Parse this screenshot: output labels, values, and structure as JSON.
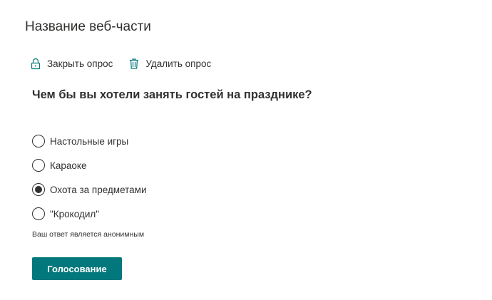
{
  "webpart": {
    "title": "Название веб-части"
  },
  "toolbar": {
    "close_poll": {
      "label": "Закрыть опрос",
      "icon": "lock-icon"
    },
    "delete_poll": {
      "label": "Удалить опрос",
      "icon": "trash-icon"
    }
  },
  "poll": {
    "question": "Чем бы вы хотели занять гостей на празднике?",
    "options": [
      {
        "label": "Настольные игры",
        "selected": false
      },
      {
        "label": "Караоке",
        "selected": false
      },
      {
        "label": "Охота за предметами",
        "selected": true
      },
      {
        "label": "\"Крокодил\"",
        "selected": false
      }
    ],
    "anonymous_note": "Ваш ответ является анонимным",
    "vote_label": "Голосование"
  },
  "colors": {
    "accent": "#03787c",
    "icon": "#03787c",
    "text": "#323130"
  }
}
